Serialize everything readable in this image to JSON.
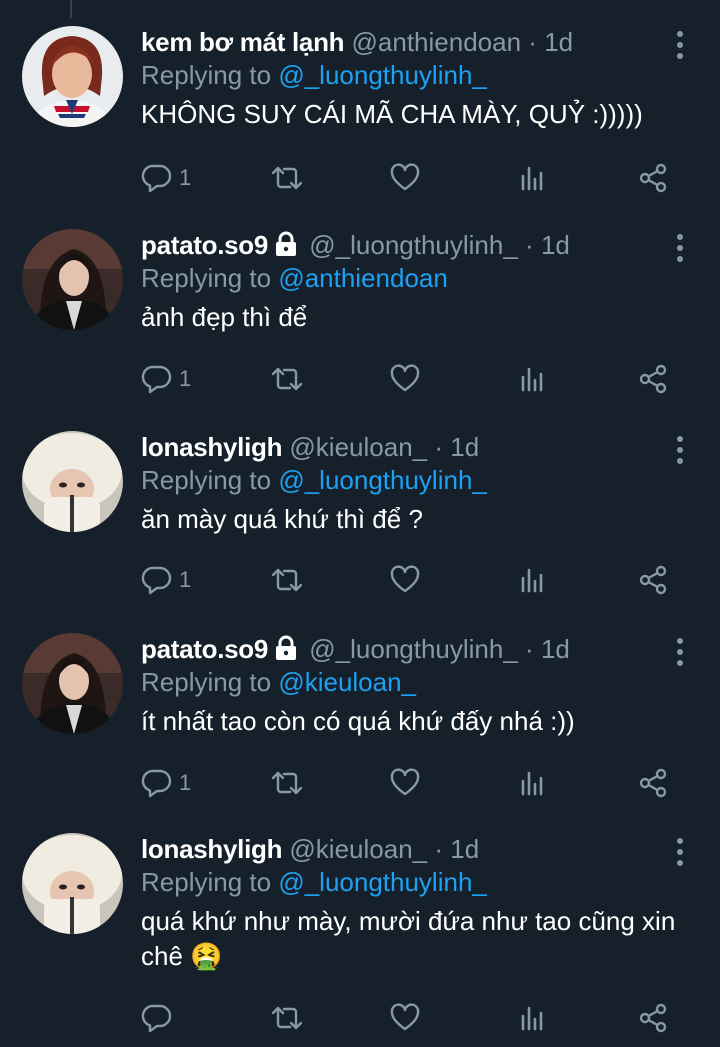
{
  "tweets": [
    {
      "name": "kem bơ mát lạnh",
      "locked": false,
      "handle": "@anthiendoan",
      "sep": "·",
      "time": "1d",
      "replying_prefix": "Replying to",
      "replying_to": "@_luongthuylinh_",
      "text": "KHÔNG SUY CÁI MÃ CHA MÀY, QUỶ :)))))",
      "reply_count": "1",
      "avatar": "avatar-red-hair"
    },
    {
      "name": "patato.so9",
      "locked": true,
      "handle": "@_luongthuylinh_",
      "sep": "·",
      "time": "1d",
      "replying_prefix": "Replying to",
      "replying_to": "@anthiendoan",
      "text": "ảnh đẹp thì để",
      "reply_count": "1",
      "avatar": "avatar-dark-hair"
    },
    {
      "name": "lonashyligh",
      "locked": false,
      "handle": "@kieuloan_",
      "sep": "·",
      "time": "1d",
      "replying_prefix": "Replying to",
      "replying_to": "@_luongthuylinh_",
      "text": "ăn mày quá khứ thì để ?",
      "reply_count": "1",
      "avatar": "avatar-fur-hat"
    },
    {
      "name": "patato.so9",
      "locked": true,
      "handle": "@_luongthuylinh_",
      "sep": "·",
      "time": "1d",
      "replying_prefix": "Replying to",
      "replying_to": "@kieuloan_",
      "text": "ít nhất tao còn có quá khứ đấy nhá :))",
      "reply_count": "1",
      "avatar": "avatar-dark-hair"
    },
    {
      "name": "lonashyligh",
      "locked": false,
      "handle": "@kieuloan_",
      "sep": "·",
      "time": "1d",
      "replying_prefix": "Replying to",
      "replying_to": "@_luongthuylinh_",
      "text": "quá khứ như mày, mười đứa như tao cũng xin chê 🤮",
      "reply_count": "",
      "avatar": "avatar-fur-hat"
    }
  ],
  "colors": {
    "background": "#15202b",
    "text_primary": "#ffffff",
    "text_secondary": "#8899a6",
    "mention": "#1da1f2",
    "divider": "#38444d"
  },
  "icons": {
    "reply": "reply-icon",
    "retweet": "retweet-icon",
    "like": "heart-icon",
    "stats": "stats-icon",
    "share": "share-icon",
    "more": "more-vertical-icon",
    "lock": "lock-icon"
  }
}
